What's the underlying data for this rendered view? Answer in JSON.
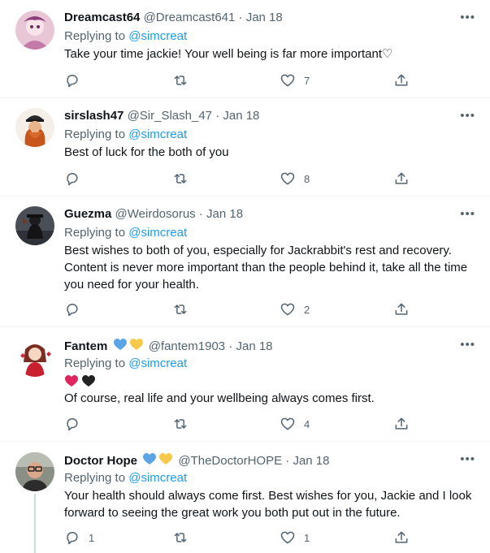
{
  "reply_prefix": "Replying to",
  "tweets": [
    {
      "name": "Dreamcast64",
      "handle": "@Dreamcast641",
      "dot": "·",
      "date": "Jan 18",
      "reply_to": "@simcreat",
      "text": "Take your time jackie! Your well being is far more important♡",
      "replies": "",
      "likes": "7"
    },
    {
      "name": "sirslash47",
      "handle": "@Sir_Slash_47",
      "dot": "·",
      "date": "Jan 18",
      "reply_to": "@simcreat",
      "text": "Best of luck for the both of you",
      "replies": "",
      "likes": "8"
    },
    {
      "name": "Guezma",
      "handle": "@Weirdosorus",
      "dot": "·",
      "date": "Jan 18",
      "reply_to": "@simcreat",
      "text_lines": [
        "Best wishes to both of you, especially for Jackrabbit's rest and recovery.",
        "Content is never more important than the people behind it, take all the time",
        "you need for your health."
      ],
      "replies": "",
      "likes": "2"
    },
    {
      "name": "Fantem",
      "handle": "@fantem1903",
      "dot": "·",
      "date": "Jan 18",
      "reply_to": "@simcreat",
      "text": "Of course, real life and your wellbeing always comes first.",
      "replies": "",
      "likes": "4"
    },
    {
      "name": "Doctor Hope",
      "handle": "@TheDoctorHOPE",
      "dot": "·",
      "date": "Jan 18",
      "reply_to": "@simcreat",
      "text_lines": [
        "Your health should always come first. Best wishes for you, Jackie and I look",
        "forward to seeing the great work you both put out in the future."
      ],
      "replies": "1",
      "likes": "1"
    }
  ],
  "more_label": "•••",
  "colors": {
    "accent": "#1d9bf0",
    "secondary": "#536471",
    "heart_blue": "#5ba4e6",
    "heart_yellow": "#f7c94a",
    "heart_red": "#e0245e",
    "heart_black": "#222222"
  }
}
